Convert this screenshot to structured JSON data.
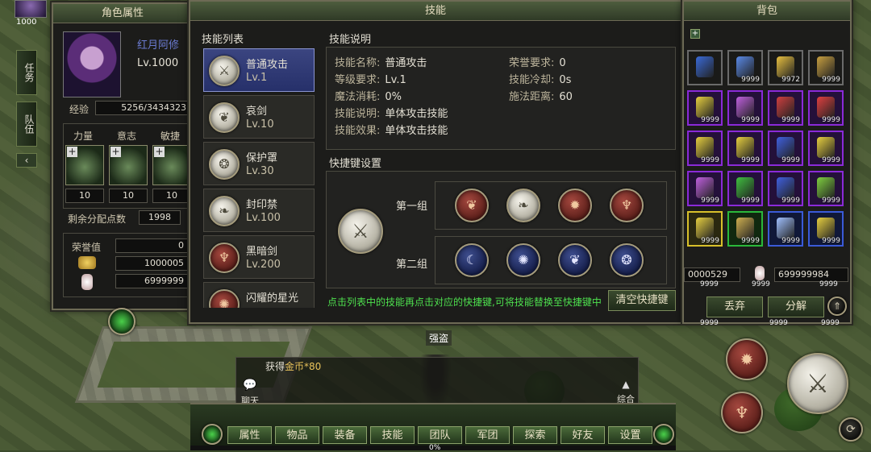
{
  "hud": {
    "top_left_value": "1000",
    "enemy_name": "强盗"
  },
  "side_tabs": [
    "任务",
    "队伍"
  ],
  "char_panel": {
    "title": "角色属性",
    "name": "红月阿修",
    "level": "Lv.1000",
    "exp_label": "经验",
    "exp_value": "5256/3434323",
    "attributes": [
      {
        "label": "力量",
        "value": "10"
      },
      {
        "label": "意志",
        "value": "10"
      },
      {
        "label": "敏捷",
        "value": "10"
      }
    ],
    "remaining_label": "剩余分配点数",
    "remaining_value": "1998",
    "honor_label": "荣誉值",
    "honor_value": "0",
    "gold_value": "1000005",
    "potion_value": "6999999"
  },
  "skill_panel": {
    "title": "技能",
    "list_header": "技能列表",
    "desc_header": "技能说明",
    "skills": [
      {
        "name": "普通攻击",
        "level": "Lv.1",
        "glyph": "⚔",
        "style": "silver",
        "active": true
      },
      {
        "name": "哀剑",
        "level": "Lv.10",
        "glyph": "❦",
        "style": "silver",
        "active": false
      },
      {
        "name": "保护罩",
        "level": "Lv.30",
        "glyph": "❂",
        "style": "silver",
        "active": false
      },
      {
        "name": "封印禁",
        "level": "Lv.100",
        "glyph": "❧",
        "style": "silver",
        "active": false
      },
      {
        "name": "黑暗剑",
        "level": "Lv.200",
        "glyph": "♆",
        "style": "red",
        "active": false
      },
      {
        "name": "闪耀的星光",
        "level": "",
        "glyph": "✺",
        "style": "red",
        "active": false
      }
    ],
    "info": {
      "name_label": "技能名称:",
      "name_value": "普通攻击",
      "level_req_label": "等级要求:",
      "level_req_value": "Lv.1",
      "mana_label": "魔法消耗:",
      "mana_value": "0%",
      "desc_label": "技能说明:",
      "desc_value": "单体攻击技能",
      "effect_label": "技能效果:",
      "effect_value": "单体攻击技能",
      "honor_label": "荣誉要求:",
      "honor_value": "0",
      "cooldown_label": "技能冷却:",
      "cooldown_value": "0s",
      "range_label": "施法距离:",
      "range_value": "60"
    },
    "hotkey_header": "快捷键设置",
    "group1_label": "第一组",
    "group2_label": "第二组",
    "group1": [
      {
        "glyph": "❦",
        "style": "red"
      },
      {
        "glyph": "❧",
        "style": "silver"
      },
      {
        "glyph": "✹",
        "style": "red"
      },
      {
        "glyph": "♆",
        "style": "red"
      }
    ],
    "group2": [
      {
        "glyph": "☾",
        "style": "blue"
      },
      {
        "glyph": "✺",
        "style": "blue"
      },
      {
        "glyph": "❦",
        "style": "blue"
      },
      {
        "glyph": "❂",
        "style": "blue"
      }
    ],
    "hint": "点击列表中的技能再点击对应的快捷键,可将技能替换至快捷键中",
    "clear_button": "清空快捷键"
  },
  "bag_panel": {
    "title": "背包",
    "slots": [
      {
        "count": "",
        "style": "plain",
        "color": "#3a6ad8"
      },
      {
        "count": "9999",
        "style": "plain",
        "color": "#5a8ae8"
      },
      {
        "count": "9972",
        "style": "plain",
        "color": "#e8c040"
      },
      {
        "count": "9999",
        "style": "plain",
        "color": "#c8a040"
      },
      {
        "count": "9999",
        "style": "purple",
        "color": "#e8d040"
      },
      {
        "count": "9999",
        "style": "purple",
        "color": "#c060e0"
      },
      {
        "count": "9999",
        "style": "purple",
        "color": "#d04040"
      },
      {
        "count": "9999",
        "style": "purple",
        "color": "#e04040"
      },
      {
        "count": "9999",
        "style": "purple",
        "color": "#e8d040"
      },
      {
        "count": "9999",
        "style": "purple",
        "color": "#e8d040"
      },
      {
        "count": "9999",
        "style": "purple",
        "color": "#4060e0"
      },
      {
        "count": "9999",
        "style": "purple",
        "color": "#e8d040"
      },
      {
        "count": "9999",
        "style": "purple",
        "color": "#c060e0"
      },
      {
        "count": "9999",
        "style": "purple",
        "color": "#40c040"
      },
      {
        "count": "9999",
        "style": "purple",
        "color": "#4060e0"
      },
      {
        "count": "9999",
        "style": "purple",
        "color": "#80d040"
      },
      {
        "count": "9999",
        "style": "gold",
        "color": "#e8d040"
      },
      {
        "count": "9999",
        "style": "green",
        "color": "#d0b050"
      },
      {
        "count": "9999",
        "style": "blue",
        "color": "#a0c0ff"
      },
      {
        "count": "9999",
        "style": "blue",
        "color": "#e8d040"
      }
    ],
    "money_value": "0000529",
    "potion_value": "699999984",
    "money_sub": "9999",
    "potion_sub": "9999",
    "extra_sub": "9999",
    "discard_button": "丢弃",
    "split_button": "分解",
    "row_counts": [
      "9999",
      "9999",
      "9999"
    ]
  },
  "chat": {
    "label": "聊天",
    "message_prefix": "获得",
    "message_item": "金币",
    "message_suffix": "*80",
    "combined_label": "综合"
  },
  "menu": {
    "items": [
      "属性",
      "物品",
      "装备",
      "技能",
      "团队",
      "军团",
      "探索",
      "好友",
      "设置"
    ],
    "progress": "0%"
  }
}
